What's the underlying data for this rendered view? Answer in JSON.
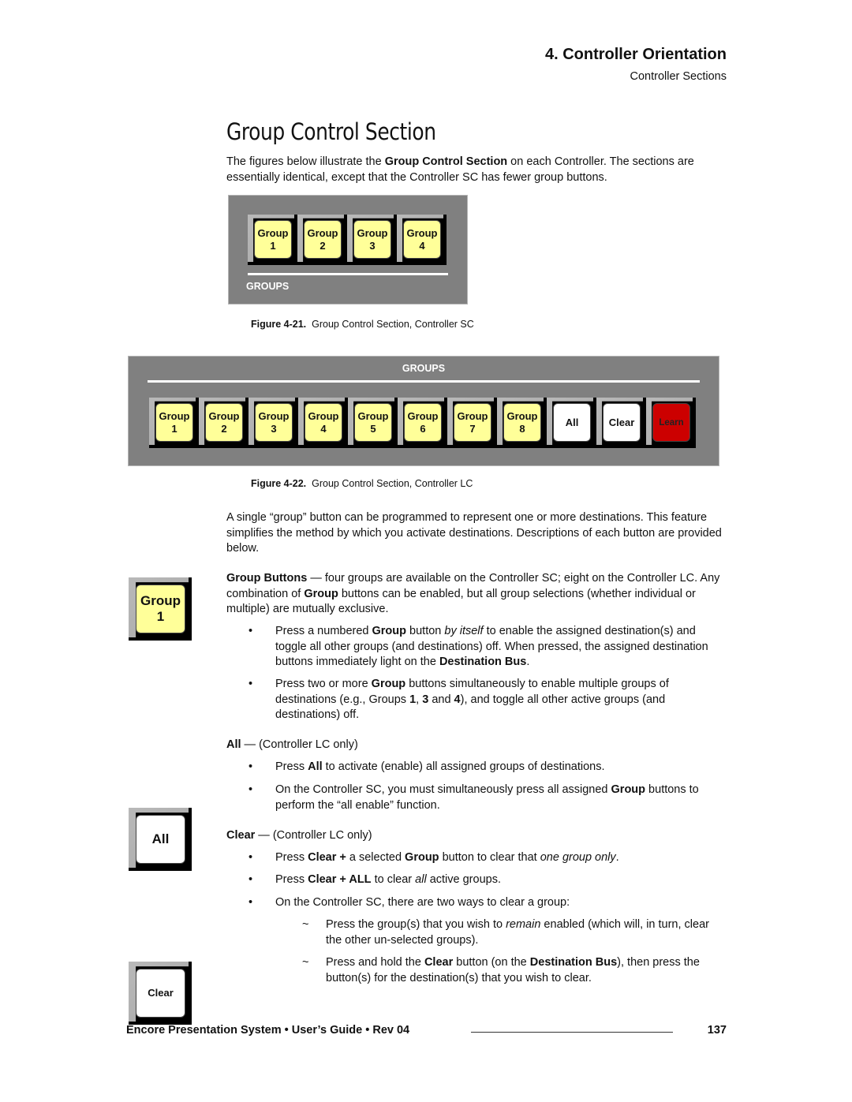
{
  "header": {
    "chapter": "4.  Controller Orientation",
    "subsection": "Controller Sections"
  },
  "section_title": "Group Control Section",
  "intro": {
    "pre": "The figures below illustrate the ",
    "bold": "Group Control Section",
    "post": " on each Controller.  The sections are essentially identical, except that the Controller SC has fewer group buttons."
  },
  "figure_sc": {
    "panel_label": "GROUPS",
    "buttons": [
      {
        "line1": "Group",
        "line2": "1",
        "color": "yellow"
      },
      {
        "line1": "Group",
        "line2": "2",
        "color": "yellow"
      },
      {
        "line1": "Group",
        "line2": "3",
        "color": "yellow"
      },
      {
        "line1": "Group",
        "line2": "4",
        "color": "yellow"
      }
    ],
    "caption_label": "Figure 4-21.",
    "caption_text": "Group Control Section, Controller SC"
  },
  "figure_lc": {
    "panel_label": "GROUPS",
    "buttons": [
      {
        "line1": "Group",
        "line2": "1",
        "color": "yellow"
      },
      {
        "line1": "Group",
        "line2": "2",
        "color": "yellow"
      },
      {
        "line1": "Group",
        "line2": "3",
        "color": "yellow"
      },
      {
        "line1": "Group",
        "line2": "4",
        "color": "yellow"
      },
      {
        "line1": "Group",
        "line2": "5",
        "color": "yellow"
      },
      {
        "line1": "Group",
        "line2": "6",
        "color": "yellow"
      },
      {
        "line1": "Group",
        "line2": "7",
        "color": "yellow"
      },
      {
        "line1": "Group",
        "line2": "8",
        "color": "yellow"
      },
      {
        "line1": "All",
        "line2": "",
        "color": "white"
      },
      {
        "line1": "Clear",
        "line2": "",
        "color": "white"
      },
      {
        "line1": "Learn",
        "line2": "",
        "color": "red"
      }
    ],
    "caption_label": "Figure 4-22.",
    "caption_text": "Group Control Section, Controller LC"
  },
  "colors": {
    "panel_gray": "#808080",
    "group_yellow": "#ffff99",
    "learn_red": "#cc0000",
    "white": "#ffffff"
  },
  "body_para": "A single “group” button can be programmed to represent one or more destinations.  This feature simplifies the method by which you activate destinations.  Descriptions of each button are provided below.",
  "group_buttons": {
    "side_key": {
      "line1": "Group",
      "line2": "1"
    },
    "lead_bold": "Group Buttons",
    "lead_a": " — four groups are available on the Controller SC; eight on the Controller LC.  Any combination of ",
    "lead_bold2": "Group",
    "lead_b": " buttons can be enabled, but all group selections (whether individual or multiple) are mutually exclusive.",
    "bullets": [
      {
        "a": "Press a numbered ",
        "b": "Group",
        "c": " button ",
        "i": "by itself",
        "d": " to enable the assigned destination(s) and toggle all other groups (and destinations) off.  When pressed, the assigned destination buttons immediately light on the ",
        "e": "Destination Bus",
        "f": "."
      },
      {
        "a": "Press two or more ",
        "b": "Group",
        "c": " buttons simultaneously to enable multiple groups of destinations (e.g., Groups ",
        "n1": "1",
        "s1": ", ",
        "n2": "3",
        "s2": " and ",
        "n3": "4",
        "d": "), and toggle all other active groups (and destinations) off."
      }
    ]
  },
  "all_section": {
    "side_key": "All",
    "heading_bold": "All",
    "heading_rest": " — (Controller LC only)",
    "bullets": [
      {
        "a": "Press ",
        "b": "All",
        "c": " to activate (enable) all assigned groups of destinations."
      },
      {
        "a": "On the Controller SC, you must simultaneously press all assigned ",
        "b": "Group",
        "c": " buttons to perform the “all enable” function."
      }
    ]
  },
  "clear_section": {
    "side_key": "Clear",
    "heading_bold": "Clear",
    "heading_rest": " — (Controller LC only)",
    "bullets": [
      {
        "a": "Press ",
        "b": "Clear +",
        "c": " a selected ",
        "d": "Group",
        "e": " button to clear that ",
        "i": "one group only",
        "f": "."
      },
      {
        "a": "Press ",
        "b": "Clear + ALL",
        "c": " to clear ",
        "i": "all",
        "d": " active groups."
      },
      {
        "a": "On the Controller SC, there are two ways to clear a group:"
      }
    ],
    "sub_bullets": [
      {
        "a": "Press the group(s) that you wish to ",
        "i": "remain",
        "b": " enabled (which will, in turn, clear the other un-selected groups)."
      },
      {
        "a": "Press and hold the ",
        "b": "Clear",
        "c": " button (on the ",
        "d": "Destination Bus",
        "e": "), then press the button(s) for the destination(s) that you wish to clear."
      }
    ],
    "bullet_mark": "•",
    "sub_mark": "~"
  },
  "footer": {
    "text": "Encore Presentation System  •  User’s Guide  •  Rev 04",
    "page_number": "137"
  }
}
